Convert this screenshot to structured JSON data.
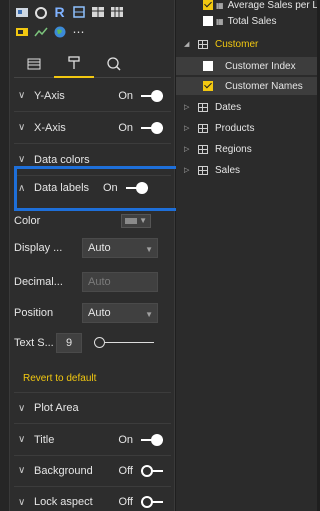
{
  "visualizations_pane": {
    "format_tabs": [
      {
        "name": "fields-tab-icon"
      },
      {
        "name": "format-paint-roller-icon",
        "active": true
      },
      {
        "name": "analytics-magnifier-icon"
      }
    ],
    "sections": [
      {
        "id": "y-axis",
        "label": "Y-Axis",
        "state": "On",
        "expanded": false
      },
      {
        "id": "x-axis",
        "label": "X-Axis",
        "state": "On",
        "expanded": false
      },
      {
        "id": "data-colors",
        "label": "Data colors",
        "expanded": false
      },
      {
        "id": "data-labels",
        "label": "Data labels",
        "state": "On",
        "expanded": true
      }
    ],
    "data_labels": {
      "color_label": "Color",
      "display_units_label": "Display ...",
      "display_units_value": "Auto",
      "decimal_places_label": "Decimal...",
      "decimal_places_placeholder": "Auto",
      "position_label": "Position",
      "position_value": "Auto",
      "text_size_label": "Text S...",
      "text_size_value": "9",
      "revert_label": "Revert to default"
    },
    "sections_below": [
      {
        "id": "plot-area",
        "label": "Plot Area",
        "expanded": false
      },
      {
        "id": "title",
        "label": "Title",
        "state": "On",
        "expanded": false
      },
      {
        "id": "background",
        "label": "Background",
        "state": "Off",
        "expanded": false
      },
      {
        "id": "lock-aspect",
        "label": "Lock aspect",
        "state": "Off",
        "expanded": false
      }
    ]
  },
  "fields_pane": {
    "items": [
      {
        "label": "Average Sales per L",
        "checked": true,
        "level": "measure"
      },
      {
        "label": "Total Sales",
        "checked": false,
        "level": "measure"
      },
      {
        "label": "Customer",
        "level": "table",
        "expanded": true,
        "active": true
      },
      {
        "label": "Customer Index",
        "checked": false,
        "level": "field"
      },
      {
        "label": "Customer Names",
        "checked": true,
        "level": "field"
      },
      {
        "label": "Dates",
        "level": "table",
        "expanded": false
      },
      {
        "label": "Products",
        "level": "table",
        "expanded": false
      },
      {
        "label": "Regions",
        "level": "table",
        "expanded": false
      },
      {
        "label": "Sales",
        "level": "table",
        "expanded": false
      }
    ]
  },
  "colors": {
    "accent": "#f2c811",
    "highlight": "#1e6fd9"
  }
}
